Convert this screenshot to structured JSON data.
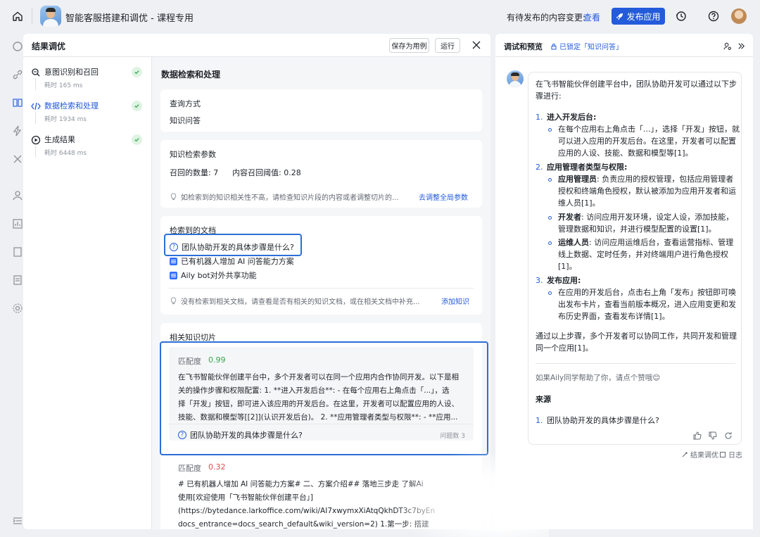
{
  "topbar": {
    "app_title": "智能客服搭建和调优 - 课程专用",
    "pending_text": "有待发布的内容变更:",
    "pending_link": "查看",
    "publish_label": "发布应用"
  },
  "result_panel": {
    "title": "结果调优",
    "save_case_label": "保存为用例",
    "run_label": "运行",
    "steps": [
      {
        "name": "意图识别和召回",
        "time": "耗时 165 ms"
      },
      {
        "name": "数据检索和处理",
        "time": "耗时 1934 ms"
      },
      {
        "name": "生成结果",
        "time": "耗时 6448 ms"
      }
    ],
    "section_title": "数据检索和处理",
    "query_card": {
      "title": "查询方式",
      "value": "知识问答"
    },
    "params_card": {
      "title": "知识检索参数",
      "recall_count": "召回的数量: 7",
      "threshold": "内容召回阈值: 0.28",
      "hint": "如检索到的知识相关性不高，请检查知识片段的内容或者调整切片的...",
      "hint_link": "去调整全局参数"
    },
    "docs_card": {
      "title": "检索到的文档",
      "items": [
        {
          "type": "question",
          "label": "团队协助开发的具体步骤是什么?"
        },
        {
          "type": "doc",
          "label": "已有机器人增加 AI 问答能力方案"
        },
        {
          "type": "doc",
          "label": "Aily bot对外共享功能"
        }
      ],
      "hint": "没有检索到相关文档，请查看是否有相关的知识文档，或在相关文档中补充...",
      "hint_link": "添加知识"
    },
    "chunks_card": {
      "title": "相关知识切片",
      "score_label": "匹配度",
      "chunks": [
        {
          "score": "0.99",
          "lines": [
            "在飞书智能伙伴创建平台中，多个开发者可以在同一个应用内合作协同开发。以下是相",
            "关的操作步骤和权限配置:   1. **进入开发后台**:   - 在每个应用右上角点击「...」，选",
            "择「开发」按钮，即可进入该应用的开发后台。在这里，开发者可以配置应用的人设、",
            "技能、数据和模型等[[2]](认识开发后台)。 2. **应用管理者类型与权限**:   - **应用..."
          ],
          "question": "团队协助开发的具体步骤是什么?",
          "question_count": "问题数 3"
        },
        {
          "score": "0.32",
          "lines": [
            "# 已有机器人增加 AI 问答能力方案# 二、方案介绍## 落地三步走 了解Ai",
            "使用[欢迎使用「飞书智能伙伴创建平台」]",
            "(https://bytedance.larkoffice.com/wiki/AI7xwymxXiAtqQkhDT3c7byEn",
            "docs_entrance=docs_search_default&wiki_version=2) 1.第一步: 搭建"
          ]
        }
      ]
    }
  },
  "preview": {
    "title": "调试和预览",
    "lock_text": "已锁定「知识问答」",
    "answer": {
      "intro": [
        "在飞书智能伙伴创建平台中，团队协助开发可以通过以下步",
        "骤进行:"
      ],
      "s1_num": "1.",
      "s1_title": "进入开发后台:",
      "s1_lines": [
        "在每个应用右上角点击「...」，选择「开发」按钮，就",
        "可以进入应用的开发后台。在这里，开发者可以配置",
        "应用的人设、技能、数据和模型等[1]。"
      ],
      "s2_num": "2.",
      "s2_title": "应用管理者类型与权限:",
      "s2_b1_title": "应用管理员",
      "s2_b1_lines": [
        ": 负责应用的授权管理，包括应用管理者",
        "授权和终端角色授权，默认被添加为应用开发者和运",
        "维人员[1]。"
      ],
      "s2_b2_title": "开发者",
      "s2_b2_lines": [
        ": 访问应用开发环境，设定人设，添加技能，",
        "管理数据和知识，并进行模型配置的设置[1]。"
      ],
      "s2_b3_title": "运维人员",
      "s2_b3_lines": [
        ": 访问应用运维后台，查看运营指标、管理",
        "线上数据、定时任务，并对终端用户进行角色授权",
        "[1]。"
      ],
      "s3_num": "3.",
      "s3_title": "发布应用:",
      "s3_lines": [
        "在应用的开发后台，点击右上角「发布」按钮即可唤",
        "出发布卡片，查看当前版本概况，进入应用变更和发",
        "布历史界面，查看发布详情[1]。"
      ],
      "outro": [
        "通过以上步骤，多个开发者可以协同工作，共同开发和管理",
        "同一个应用[1]。"
      ],
      "like_prompt": "如果Aily同学帮助了你，请点个赞哦😊",
      "source_title": "来源",
      "source_num": "1.",
      "source_item": "团队协助开发的具体步骤是什么?"
    },
    "footer_result_tune": "结果调优",
    "footer_log": "日志"
  }
}
